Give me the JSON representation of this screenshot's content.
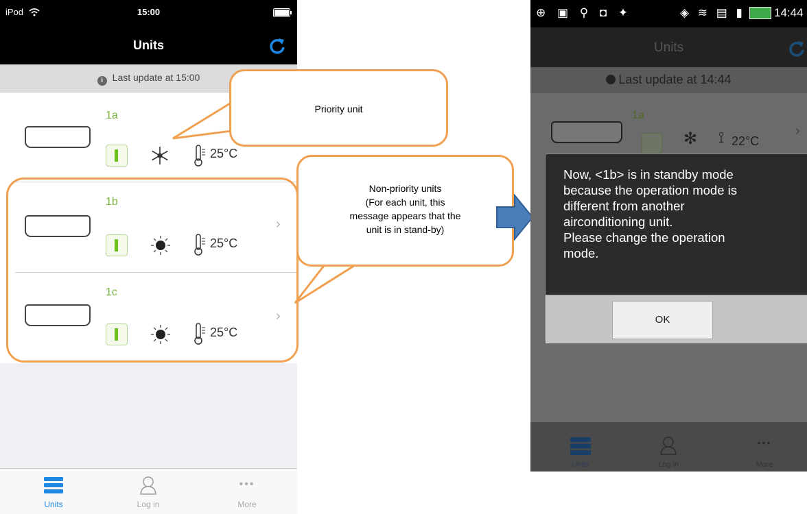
{
  "ios": {
    "status": {
      "carrier": "iPod",
      "time": "15:00"
    },
    "nav": {
      "title": "Units"
    },
    "banner": {
      "text": "Last update at 15:00"
    },
    "units": [
      {
        "name": "1a",
        "temp": "25°C",
        "mode": "cool"
      },
      {
        "name": "1b",
        "temp": "25°C",
        "mode": "heat"
      },
      {
        "name": "1c",
        "temp": "25°C",
        "mode": "heat"
      }
    ],
    "tabs": [
      {
        "label": "Units",
        "active": true
      },
      {
        "label": "Log in",
        "active": false
      },
      {
        "label": "More",
        "active": false
      }
    ],
    "colors": {
      "accent": "#1e88e5",
      "unit_name": "#7cb342",
      "power_on": "#6cc21a"
    }
  },
  "callouts": {
    "priority": "Priority unit",
    "non_priority": [
      "Non-priority units",
      "(For each unit, this",
      "message appears that the",
      "unit is in stand-by)"
    ]
  },
  "android": {
    "status": {
      "time": "14:44"
    },
    "nav": {
      "title": "Units"
    },
    "banner": {
      "text": "Last update at 14:44"
    },
    "unit": {
      "name": "1a",
      "temp": "22°C"
    },
    "dialog": {
      "lines": [
        "Now, <1b> is in standby mode",
        "because the operation mode is",
        "different from another",
        "airconditioning unit.",
        "Please change the operation",
        "mode."
      ],
      "ok_label": "OK"
    },
    "tabs": [
      {
        "label": "Units"
      },
      {
        "label": "Log in"
      },
      {
        "label": "More"
      }
    ]
  }
}
